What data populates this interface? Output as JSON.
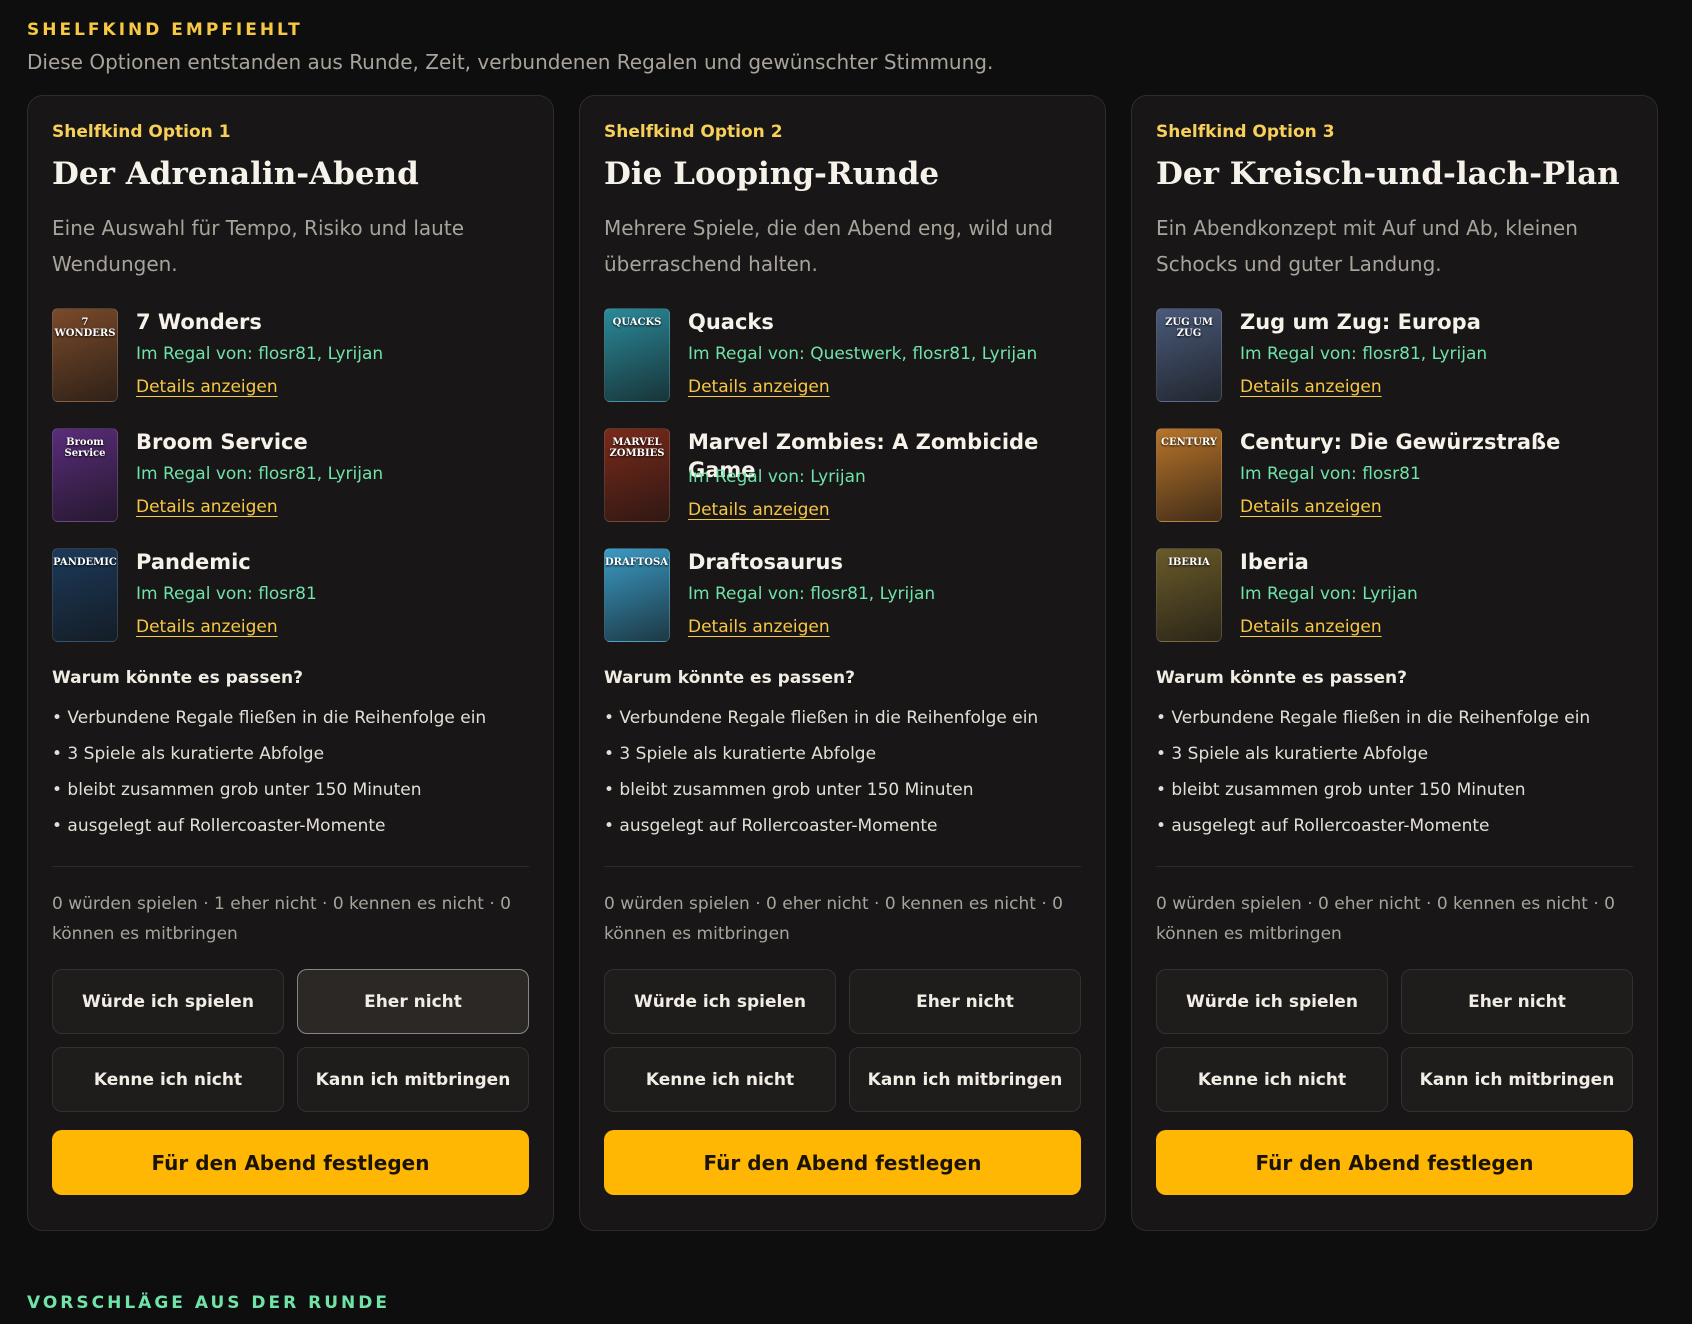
{
  "header": {
    "eyebrow": "SHELFKIND EMPFIEHLT",
    "intro": "Diese Optionen entstanden aus Runde, Zeit, verbundenen Regalen und gewünschter Stimmung."
  },
  "section2": {
    "eyebrow": "VORSCHLÄGE AUS DER RUNDE"
  },
  "labels": {
    "why_title": "Warum könnte es passen?",
    "details": "Details anzeigen",
    "btn_play": "Würde ich spielen",
    "btn_rather_not": "Eher nicht",
    "btn_unknown": "Kenne ich nicht",
    "btn_bring": "Kann ich mitbringen",
    "cta": "Für den Abend festlegen"
  },
  "cards": [
    {
      "option_label": "Shelfkind Option 1",
      "title": "Der Adrenalin-Abend",
      "description": "Eine Auswahl für Tempo, Risiko und laute Wendungen.",
      "games": [
        {
          "name": "7 Wonders",
          "shelf": "Im Regal von: flosr81, Lyrijan",
          "cover_text": "7 WONDERS",
          "cover_color": "#7a4a2a"
        },
        {
          "name": "Broom Service",
          "shelf": "Im Regal von: flosr81, Lyrijan",
          "cover_text": "Broom Service",
          "cover_color": "#5a2c7a"
        },
        {
          "name": "Pandemic",
          "shelf": "Im Regal von: flosr81",
          "cover_text": "PANDEMIC",
          "cover_color": "#1c3a5a"
        }
      ],
      "reasons": [
        "• Verbundene Regale fließen in die Reihenfolge ein",
        "• 3 Spiele als kuratierte Abfolge",
        "• bleibt zusammen grob unter 150 Minuten",
        "• ausgelegt auf Rollercoaster-Momente"
      ],
      "votes": "0 würden spielen · 1 eher nicht · 0 kennen es nicht · 0 können es mitbringen",
      "selected": "rather_not"
    },
    {
      "option_label": "Shelfkind Option 2",
      "title": "Die Looping-Runde",
      "description": "Mehrere Spiele, die den Abend eng, wild und überraschend halten.",
      "games": [
        {
          "name": "Quacks",
          "shelf": "Im Regal von: Questwerk, flosr81, Lyrijan",
          "cover_text": "QUACKS",
          "cover_color": "#2a8a9a"
        },
        {
          "name": "Marvel Zombies: A Zombicide Game",
          "shelf": "Im Regal von: Lyrijan",
          "cover_text": "MARVEL ZOMBIES",
          "cover_color": "#7a2a1a"
        },
        {
          "name": "Draftosaurus",
          "shelf": "Im Regal von: flosr81, Lyrijan",
          "cover_text": "DRAFTOSAURUS",
          "cover_color": "#3a9ac4"
        }
      ],
      "reasons": [
        "• Verbundene Regale fließen in die Reihenfolge ein",
        "• 3 Spiele als kuratierte Abfolge",
        "• bleibt zusammen grob unter 150 Minuten",
        "• ausgelegt auf Rollercoaster-Momente"
      ],
      "votes": "0 würden spielen · 0 eher nicht · 0 kennen es nicht · 0 können es mitbringen",
      "selected": ""
    },
    {
      "option_label": "Shelfkind Option 3",
      "title": "Der Kreisch-und-lach-Plan",
      "description": "Ein Abendkonzept mit Auf und Ab, kleinen Schocks und guter Landung.",
      "games": [
        {
          "name": "Zug um Zug: Europa",
          "shelf": "Im Regal von: flosr81, Lyrijan",
          "cover_text": "ZUG UM ZUG",
          "cover_color": "#4a5a7a"
        },
        {
          "name": "Century: Die Gewürzstraße",
          "shelf": "Im Regal von: flosr81",
          "cover_text": "CENTURY",
          "cover_color": "#b8742a"
        },
        {
          "name": "Iberia",
          "shelf": "Im Regal von: Lyrijan",
          "cover_text": "IBERIA",
          "cover_color": "#6a5a2a"
        }
      ],
      "reasons": [
        "• Verbundene Regale fließen in die Reihenfolge ein",
        "• 3 Spiele als kuratierte Abfolge",
        "• bleibt zusammen grob unter 150 Minuten",
        "• ausgelegt auf Rollercoaster-Momente"
      ],
      "votes": "0 würden spielen · 0 eher nicht · 0 kennen es nicht · 0 können es mitbringen",
      "selected": ""
    }
  ]
}
